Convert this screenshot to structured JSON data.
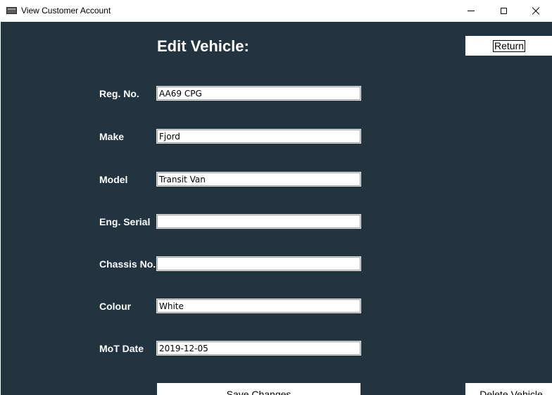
{
  "window": {
    "title": "View Customer Account",
    "icon": "app-window-icon",
    "controls": [
      "minimize-icon",
      "maximize-icon",
      "close-icon"
    ]
  },
  "form": {
    "heading": "Edit Vehicle:",
    "return_label": "Return",
    "fields": [
      {
        "label": "Reg. No.",
        "value": "AA69 CPG"
      },
      {
        "label": "Make",
        "value": "Fjord"
      },
      {
        "label": "Model",
        "value": "Transit Van"
      },
      {
        "label": "Eng. Serial",
        "value": ""
      },
      {
        "label": "Chassis No.",
        "value": ""
      },
      {
        "label": "Colour",
        "value": "White"
      },
      {
        "label": "MoT Date",
        "value": "2019-12-05"
      }
    ],
    "save_label": "Save Changes",
    "delete_label": "Delete Vehicle"
  },
  "colors": {
    "background": "#213440",
    "text": "#ffffff",
    "button": "#ffffff"
  }
}
